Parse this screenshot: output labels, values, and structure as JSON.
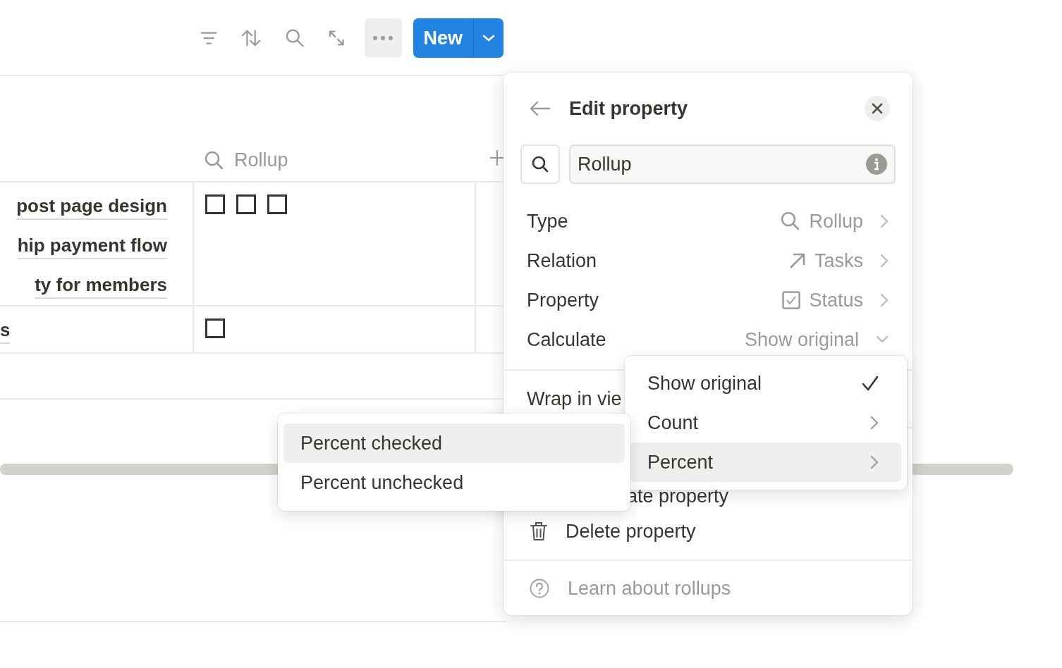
{
  "toolbar": {
    "new_button": "New"
  },
  "table": {
    "columns": [
      {
        "label": "Rollup"
      }
    ],
    "rows": [
      {
        "links": [
          "post page design",
          "hip payment flow",
          "ty for members"
        ],
        "checkboxes": [
          {
            "checked": false
          },
          {
            "checked": false
          },
          {
            "checked": false
          }
        ]
      },
      {
        "links": [
          "s"
        ],
        "checkboxes": [
          {
            "checked": false
          }
        ]
      }
    ]
  },
  "edit_property": {
    "title": "Edit property",
    "name_value": "Rollup",
    "fields": [
      {
        "label": "Type",
        "value": "Rollup",
        "kind": "link"
      },
      {
        "label": "Relation",
        "value": "Tasks",
        "kind": "link"
      },
      {
        "label": "Property",
        "value": "Status",
        "kind": "link"
      },
      {
        "label": "Calculate",
        "value": "Show original",
        "kind": "dropdown"
      }
    ],
    "wrap_label": "Wrap in vie",
    "duplicate_label": "ate property",
    "delete_label": "Delete property",
    "learn_label": "Learn about rollups"
  },
  "calculate_menu": {
    "items": [
      {
        "label": "Show original",
        "kind": "check",
        "checked": true,
        "selected": false
      },
      {
        "label": "Count",
        "kind": "submenu",
        "selected": false
      },
      {
        "label": "Percent",
        "kind": "submenu",
        "selected": true
      }
    ]
  },
  "percent_menu": {
    "items": [
      {
        "label": "Percent checked",
        "selected": true
      },
      {
        "label": "Percent unchecked",
        "selected": false
      }
    ]
  }
}
